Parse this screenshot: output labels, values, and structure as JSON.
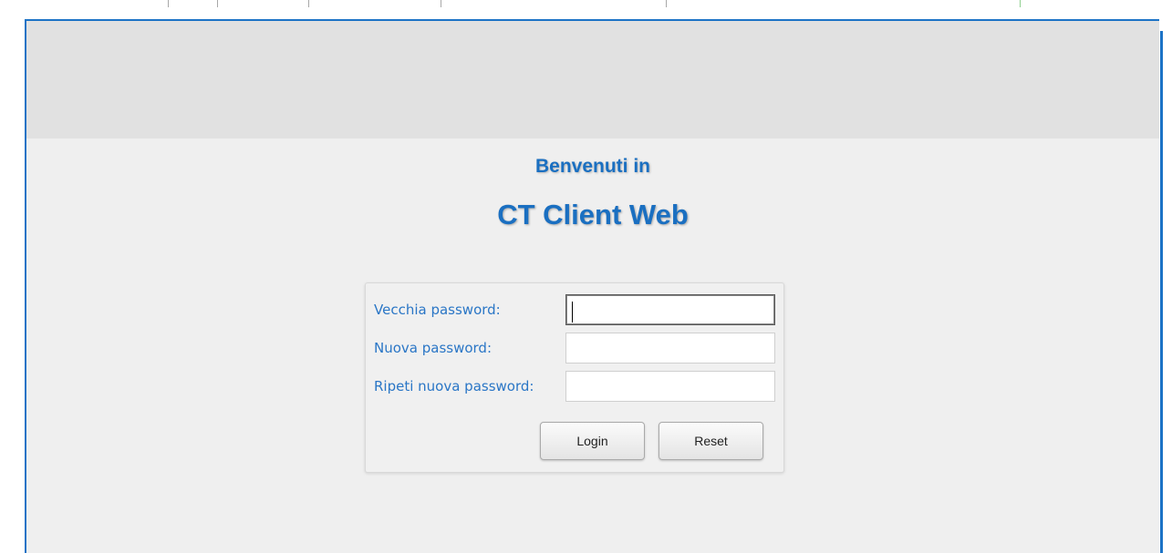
{
  "welcome_text": "Benvenuti in",
  "app_title": "CT Client Web",
  "form": {
    "old_password_label": "Vecchia password:",
    "old_password_value": "",
    "new_password_label": "Nuova password:",
    "new_password_value": "",
    "repeat_password_label": "Ripeti nuova password:",
    "repeat_password_value": "",
    "login_label": "Login",
    "reset_label": "Reset"
  },
  "colors": {
    "accent": "#1c73c6",
    "label_blue": "#2a76c6",
    "header_band": "#e1e1e1",
    "background": "#efefef"
  }
}
